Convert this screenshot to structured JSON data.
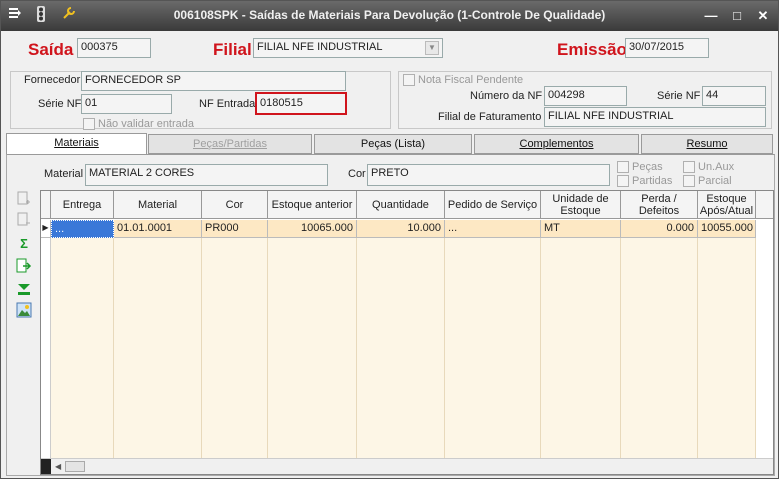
{
  "window": {
    "title": "006108SPK - Saídas de Materiais Para Devolução (1-Controle De Qualidade)",
    "minimize": "—",
    "maximize": "□",
    "close": "✕"
  },
  "header": {
    "saida_label": "Saída",
    "saida_value": "000375",
    "filial_label": "Filial",
    "filial_value": "FILIAL NFE INDUSTRIAL",
    "emissao_label": "Emissão",
    "emissao_value": "30/07/2015"
  },
  "supplier": {
    "fornecedor_label": "Fornecedor",
    "fornecedor_value": "FORNECEDOR SP",
    "serie_nf_label": "Série NF",
    "serie_nf_value": "01",
    "nf_entrada_label": "NF Entrada",
    "nf_entrada_value": "0180515",
    "nao_validar_label": "Não validar entrada"
  },
  "invoice": {
    "nota_fiscal_pendente_label": "Nota Fiscal Pendente",
    "numero_nf_label": "Número da NF",
    "numero_nf_value": "004298",
    "serie_nf_label": "Série NF",
    "serie_nf_value": "44",
    "filial_faturamento_label": "Filial de Faturamento",
    "filial_faturamento_value": "FILIAL NFE INDUSTRIAL"
  },
  "tabs": [
    "Materiais",
    "Peças/Partidas",
    "Peças (Lista)",
    "Complementos",
    "Resumo"
  ],
  "filter": {
    "material_label": "Material",
    "material_value": "MATERIAL 2 CORES",
    "cor_label": "Cor",
    "cor_value": "PRETO",
    "pecas_label": "Peças",
    "partidas_label": "Partidas",
    "un_aux_label": "Un.Aux",
    "parcial_label": "Parcial"
  },
  "grid": {
    "columns": [
      "Entrega",
      "Material",
      "Cor",
      "Estoque anterior",
      "Quantidade",
      "Pedido de Serviço",
      "Unidade de Estoque",
      "Perda / Defeitos",
      "Estoque Após/Atual"
    ],
    "rows": [
      [
        "...",
        "01.01.0001",
        "PR000",
        "10065.000",
        "10.000",
        "...",
        "MT",
        "0.000",
        "10055.000"
      ]
    ]
  },
  "colors": {
    "accent_red": "#d0141c",
    "titlebar_text": "#f0f0f0",
    "row_highlight": "#fde8c4",
    "selected_cell": "#3a78d8"
  },
  "icons": [
    "menu-icon",
    "traffic-light-icon",
    "wrench-icon",
    "add-row-icon",
    "remove-row-icon",
    "sum-icon",
    "export-icon",
    "move-down-icon",
    "image-icon"
  ]
}
